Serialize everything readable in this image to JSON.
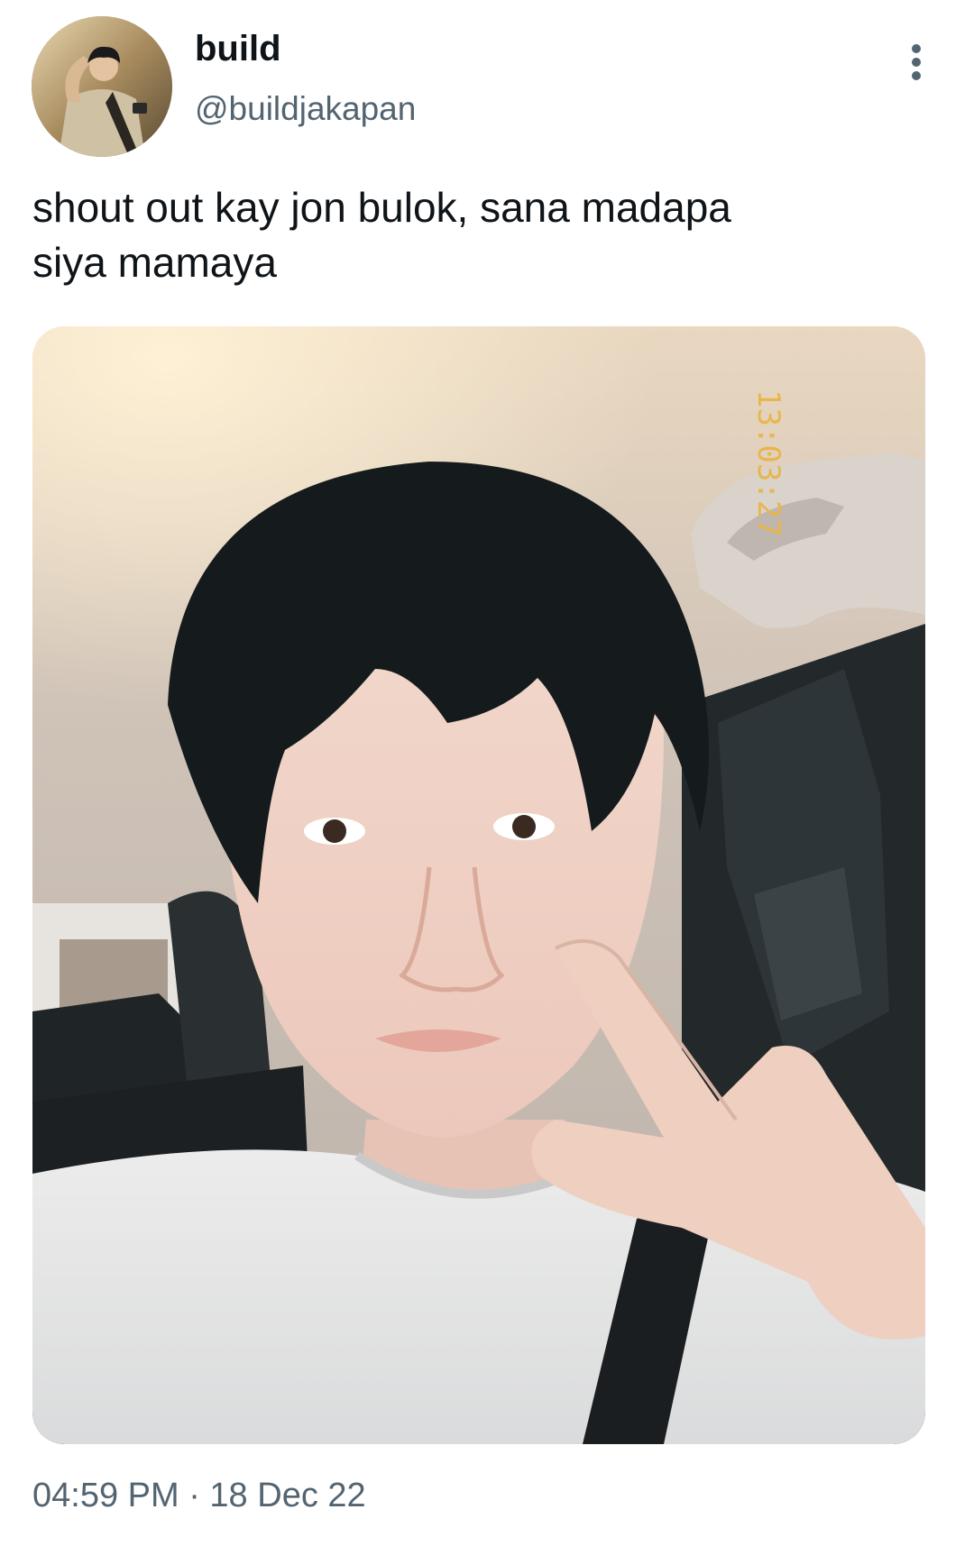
{
  "tweet": {
    "author": {
      "display_name": "build",
      "handle": "@buildjakapan"
    },
    "text": "shout out kay jon bulok, sana madapa\nsiya mamaya",
    "media": {
      "overlay_time": "13:03:27"
    },
    "time": "04:59 PM",
    "date": "18 Dec 22",
    "timestamp": "04:59 PM · 18 Dec 22"
  },
  "icons": {
    "more": "more-vertical-icon"
  },
  "colors": {
    "text_primary": "#0f1419",
    "text_secondary": "#536471",
    "background": "#ffffff"
  }
}
